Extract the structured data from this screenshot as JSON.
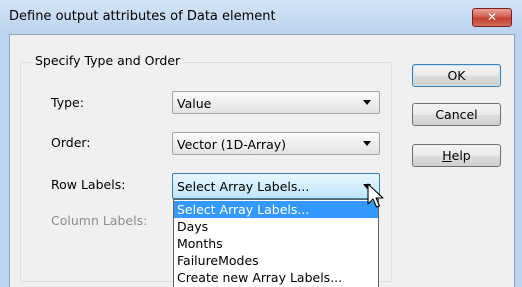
{
  "window": {
    "title": "Define output attributes of Data element",
    "close_label": "✕"
  },
  "group": {
    "legend": "Specify Type and Order"
  },
  "fields": {
    "type": {
      "label": "Type:",
      "value": "Value"
    },
    "order": {
      "label": "Order:",
      "value": "Vector (1D-Array)"
    },
    "row_labels": {
      "label": "Row Labels:",
      "value": "Select Array Labels..."
    },
    "column_labels": {
      "label": "Column Labels:"
    }
  },
  "dropdown": {
    "options": [
      "Select Array Labels...",
      "Days",
      "Months",
      "FailureModes",
      "Create new Array Labels..."
    ],
    "selected_index": 0
  },
  "buttons": {
    "ok": "OK",
    "cancel": "Cancel",
    "help_underlined": "H",
    "help_rest": "elp"
  },
  "colors": {
    "selection": "#3399ff",
    "frame": "#bcd3ee",
    "close": "#c13b2c"
  }
}
